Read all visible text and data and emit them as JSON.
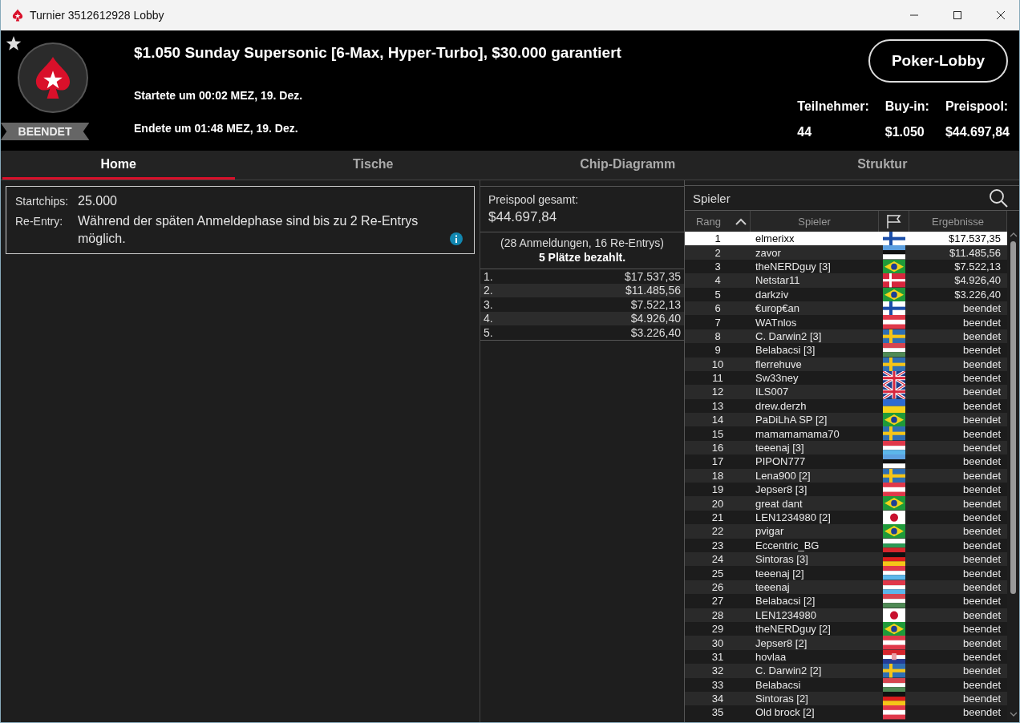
{
  "window": {
    "title": "Turnier 3512612928 Lobby"
  },
  "header": {
    "status": "BEENDET",
    "title": "$1.050 Sunday Supersonic [6-Max, Hyper-Turbo], $30.000 garantiert",
    "started": "Startete um 00:02 MEZ, 19. Dez.",
    "ended": "Endete um 01:48 MEZ, 19. Dez.",
    "lobby_button": "Poker-Lobby",
    "stats": [
      {
        "label": "Teilnehmer:",
        "value": "44"
      },
      {
        "label": "Buy-in:",
        "value": "$1.050"
      },
      {
        "label": "Preispool:",
        "value": "$44.697,84"
      }
    ]
  },
  "tabs": [
    {
      "label": "Home",
      "selected": true
    },
    {
      "label": "Tische",
      "selected": false
    },
    {
      "label": "Chip-Diagramm",
      "selected": false
    },
    {
      "label": "Struktur",
      "selected": false
    }
  ],
  "details": [
    {
      "label": "Startchips:",
      "value": "25.000"
    },
    {
      "label": "Re-Entry:",
      "value": "Während der späten Anmeldephase sind bis zu 2 Re-Entrys möglich.",
      "info": true
    }
  ],
  "prize_pool": {
    "label": "Preispool gesamt:",
    "amount": "$44.697,84",
    "entries": "(28 Anmeldungen, 16 Re-Entrys)",
    "paid": "5 Plätze bezahlt.",
    "payouts": [
      {
        "place": "1.",
        "amount": "$17.537,35"
      },
      {
        "place": "2.",
        "amount": "$11.485,56"
      },
      {
        "place": "3.",
        "amount": "$7.522,13"
      },
      {
        "place": "4.",
        "amount": "$4.926,40"
      },
      {
        "place": "5.",
        "amount": "$3.226,40"
      }
    ]
  },
  "players": {
    "search_label": "Spieler",
    "columns": [
      "Rang",
      "Spieler",
      "Ergebnisse"
    ],
    "rows": [
      {
        "rank": "1",
        "name": "elmerixx",
        "flag": {
          "kind": "fi"
        },
        "result": "$17.537,35",
        "selected": true
      },
      {
        "rank": "2",
        "name": "zavor",
        "flag": {
          "kind": "ee"
        },
        "result": "$11.485,56",
        "selected": false
      },
      {
        "rank": "3",
        "name": "theNERDguy [3]",
        "flag": {
          "kind": "br"
        },
        "result": "$7.522,13",
        "selected": false
      },
      {
        "rank": "4",
        "name": "Netstar11",
        "flag": {
          "kind": "dk"
        },
        "result": "$4.926,40",
        "selected": false
      },
      {
        "rank": "5",
        "name": "darkziv",
        "flag": {
          "kind": "br"
        },
        "result": "$3.226,40",
        "selected": false
      },
      {
        "rank": "6",
        "name": "€urop€an",
        "flag": {
          "kind": "fi"
        },
        "result": "beendet",
        "selected": false
      },
      {
        "rank": "7",
        "name": "WATnlos",
        "flag": {
          "kind": "at"
        },
        "result": "beendet",
        "selected": false
      },
      {
        "rank": "8",
        "name": "C. Darwin2 [3]",
        "flag": {
          "kind": "se"
        },
        "result": "beendet",
        "selected": false
      },
      {
        "rank": "9",
        "name": "Belabacsi [3]",
        "flag": {
          "kind": "hu"
        },
        "result": "beendet",
        "selected": false
      },
      {
        "rank": "10",
        "name": "flerrehuve",
        "flag": {
          "kind": "se"
        },
        "result": "beendet",
        "selected": false
      },
      {
        "rank": "11",
        "name": "Sw33ney",
        "flag": {
          "kind": "gb"
        },
        "result": "beendet",
        "selected": false
      },
      {
        "rank": "12",
        "name": "ILS007",
        "flag": {
          "kind": "gb"
        },
        "result": "beendet",
        "selected": false
      },
      {
        "rank": "13",
        "name": "drew.derzh",
        "flag": {
          "kind": "ua"
        },
        "result": "beendet",
        "selected": false
      },
      {
        "rank": "14",
        "name": "PaDiLhA SP [2]",
        "flag": {
          "kind": "br"
        },
        "result": "beendet",
        "selected": false
      },
      {
        "rank": "15",
        "name": "mamamamama70",
        "flag": {
          "kind": "se"
        },
        "result": "beendet",
        "selected": false
      },
      {
        "rank": "16",
        "name": "teeenaj [3]",
        "flag": {
          "kind": "lu"
        },
        "result": "beendet",
        "selected": false
      },
      {
        "rank": "17",
        "name": "PIPON777",
        "flag": {
          "kind": "ee"
        },
        "result": "beendet",
        "selected": false
      },
      {
        "rank": "18",
        "name": "Lena900 [2]",
        "flag": {
          "kind": "se"
        },
        "result": "beendet",
        "selected": false
      },
      {
        "rank": "19",
        "name": "Jepser8 [3]",
        "flag": {
          "kind": "at"
        },
        "result": "beendet",
        "selected": false
      },
      {
        "rank": "20",
        "name": "great dant",
        "flag": {
          "kind": "br"
        },
        "result": "beendet",
        "selected": false
      },
      {
        "rank": "21",
        "name": "LEN1234980 [2]",
        "flag": {
          "kind": "jp"
        },
        "result": "beendet",
        "selected": false
      },
      {
        "rank": "22",
        "name": "pvigar",
        "flag": {
          "kind": "br"
        },
        "result": "beendet",
        "selected": false
      },
      {
        "rank": "23",
        "name": "Eccentric_BG",
        "flag": {
          "kind": "bg"
        },
        "result": "beendet",
        "selected": false
      },
      {
        "rank": "24",
        "name": "Sintoras [3]",
        "flag": {
          "kind": "de"
        },
        "result": "beendet",
        "selected": false
      },
      {
        "rank": "25",
        "name": "teeenaj [2]",
        "flag": {
          "kind": "lu"
        },
        "result": "beendet",
        "selected": false
      },
      {
        "rank": "26",
        "name": "teeenaj",
        "flag": {
          "kind": "lu"
        },
        "result": "beendet",
        "selected": false
      },
      {
        "rank": "27",
        "name": "Belabacsi [2]",
        "flag": {
          "kind": "hu"
        },
        "result": "beendet",
        "selected": false
      },
      {
        "rank": "28",
        "name": "LEN1234980",
        "flag": {
          "kind": "jp"
        },
        "result": "beendet",
        "selected": false
      },
      {
        "rank": "29",
        "name": "theNERDguy [2]",
        "flag": {
          "kind": "br"
        },
        "result": "beendet",
        "selected": false
      },
      {
        "rank": "30",
        "name": "Jepser8 [2]",
        "flag": {
          "kind": "at"
        },
        "result": "beendet",
        "selected": false
      },
      {
        "rank": "31",
        "name": "hovlaa",
        "flag": {
          "kind": "hr"
        },
        "result": "beendet",
        "selected": false
      },
      {
        "rank": "32",
        "name": "C. Darwin2 [2]",
        "flag": {
          "kind": "se"
        },
        "result": "beendet",
        "selected": false
      },
      {
        "rank": "33",
        "name": "Belabacsi",
        "flag": {
          "kind": "hu"
        },
        "result": "beendet",
        "selected": false
      },
      {
        "rank": "34",
        "name": "Sintoras [2]",
        "flag": {
          "kind": "de"
        },
        "result": "beendet",
        "selected": false
      },
      {
        "rank": "35",
        "name": "Old brock [2]",
        "flag": {
          "kind": "at"
        },
        "result": "beendet",
        "selected": false
      }
    ]
  }
}
